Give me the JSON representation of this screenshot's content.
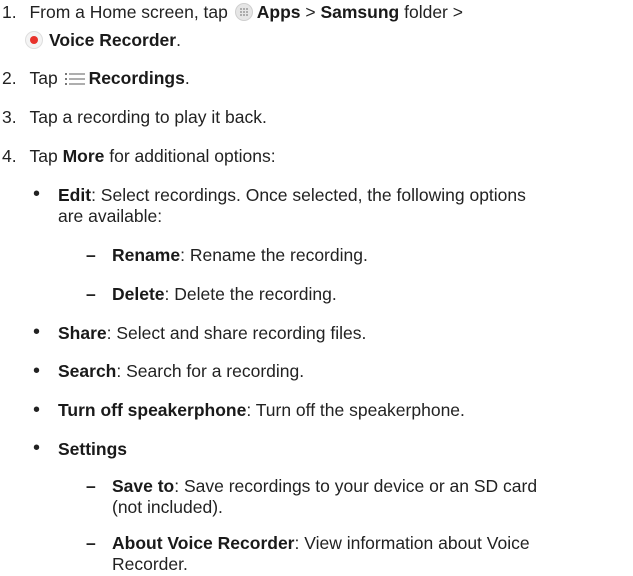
{
  "steps": [
    {
      "number": "1.",
      "prefix": "From a Home screen, tap ",
      "apps": "Apps",
      "sep1": " > ",
      "samsung": "Samsung",
      "folder": " folder >",
      "voice_recorder": "Voice Recorder",
      "end": "."
    },
    {
      "number": "2.",
      "prefix": "Tap ",
      "recordings": "Recordings",
      "end": "."
    },
    {
      "number": "3.",
      "text": "Tap a recording to play it back."
    },
    {
      "number": "4.",
      "prefix": "Tap ",
      "more": "More",
      "suffix": " for additional options:"
    }
  ],
  "options": {
    "edit": {
      "label": "Edit",
      "desc_line1": ": Select recordings. Once selected, the following options",
      "desc_line2": "are available:"
    },
    "rename": {
      "label": "Rename",
      "desc": ": Rename the recording."
    },
    "delete": {
      "label": "Delete",
      "desc": ": Delete the recording."
    },
    "share": {
      "label": "Share",
      "desc": ": Select and share recording files."
    },
    "search": {
      "label": "Search",
      "desc": ": Search for a recording."
    },
    "speaker": {
      "label": "Turn off speakerphone",
      "desc": ": Turn off the speakerphone."
    },
    "settings": {
      "label": "Settings"
    },
    "save_to": {
      "label": "Save to",
      "desc_line1": ": Save recordings to your device or an SD card",
      "desc_line2": "(not included)."
    },
    "about": {
      "label": "About Voice Recorder",
      "desc_line1": ": View information about Voice",
      "desc_line2": "Recorder."
    }
  },
  "bullet_char": "•",
  "dash_char": "–",
  "icons": {
    "apps": "apps-grid-icon",
    "recorder": "voice-recorder-icon",
    "menu": "list-menu-icon"
  },
  "colors": {
    "recorder_dot": "#e8322b"
  }
}
